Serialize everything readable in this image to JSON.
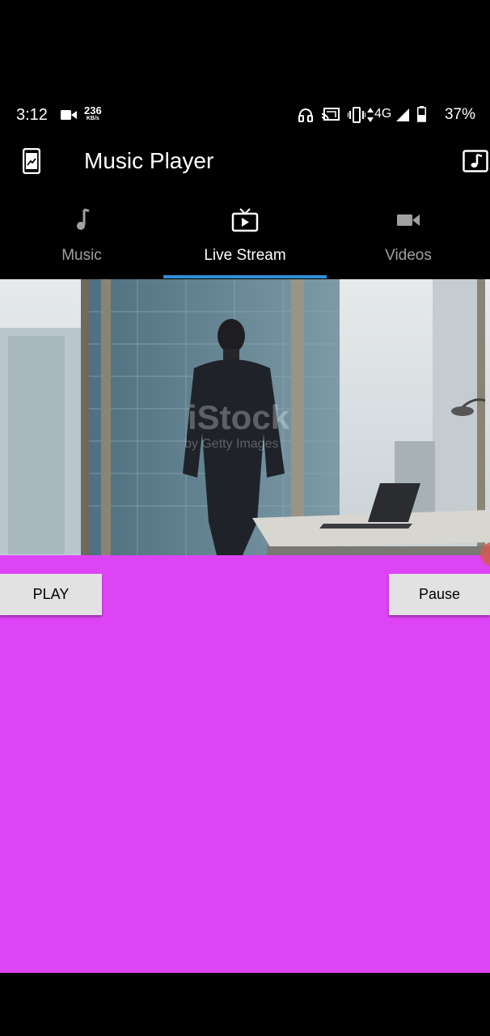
{
  "status_bar": {
    "time": "3:12",
    "speed_value": "236",
    "speed_unit": "KB/s",
    "network": "4G",
    "battery": "37%",
    "icons": [
      "video-call-icon",
      "headphones-icon",
      "cast-icon",
      "vibrate-icon",
      "signal-icon",
      "battery-icon"
    ]
  },
  "app_bar": {
    "title": "Music Player",
    "leading_icon": "phone-icon",
    "action_icon": "music-note-icon"
  },
  "tabs": [
    {
      "label": "Music",
      "icon": "music-note-icon",
      "active": false
    },
    {
      "label": "Live Stream",
      "icon": "tv-icon",
      "active": true
    },
    {
      "label": "Videos",
      "icon": "videocam-icon",
      "active": false
    }
  ],
  "video": {
    "watermark": "iStock",
    "watermark_sub": "by Getty Images"
  },
  "controls": {
    "play_label": "PLAY",
    "pause_label": "Pause"
  },
  "colors": {
    "background": "#000000",
    "content": "#dd44f5",
    "tab_indicator": "#2f8fd6",
    "button": "#e2e2e2"
  }
}
